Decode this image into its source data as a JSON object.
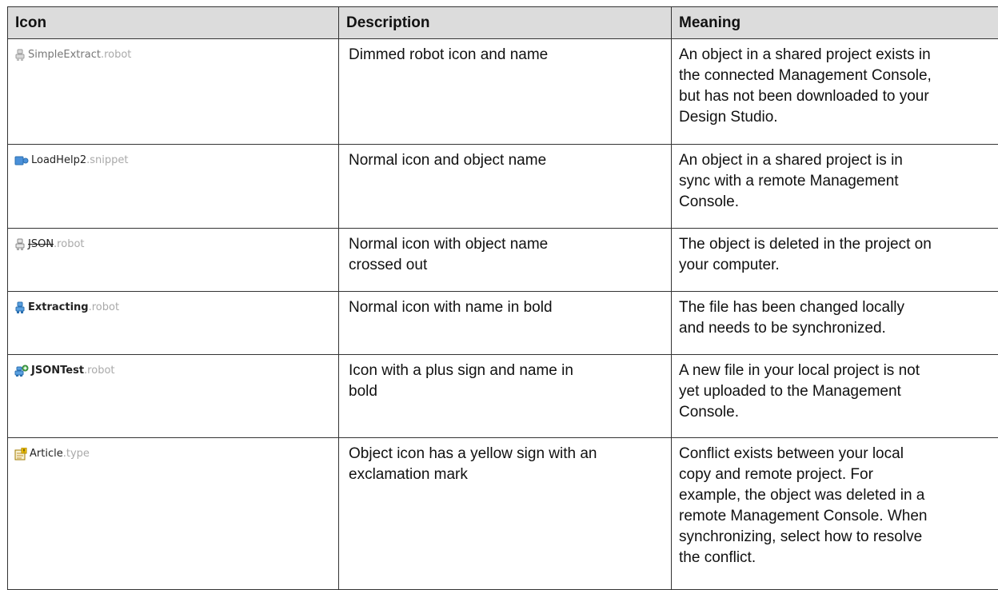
{
  "headers": {
    "icon": "Icon",
    "description": "Description",
    "meaning": "Meaning"
  },
  "rows": [
    {
      "icon_name": "robot-dimmed-icon",
      "name": "SimpleExtract",
      "ext": ".robot",
      "description": [
        "Dimmed robot icon and name"
      ],
      "meaning": [
        "An object in a shared project exists in",
        "the connected Management Console,",
        "but has not been downloaded to your",
        "Design Studio."
      ]
    },
    {
      "icon_name": "snippet-icon",
      "name": "LoadHelp2",
      "ext": ".snippet",
      "description": [
        "Normal icon and object name"
      ],
      "meaning": [
        "An object in a shared project is in",
        "sync with a remote Management",
        "Console."
      ]
    },
    {
      "icon_name": "robot-icon",
      "name": "JSON",
      "ext": ".robot",
      "description": [
        "Normal icon with object name",
        "crossed out"
      ],
      "meaning": [
        "The object is deleted in the project on",
        "your computer."
      ]
    },
    {
      "icon_name": "robot-blue-icon",
      "name": "Extracting",
      "ext": ".robot",
      "description": [
        "Normal icon with name in bold"
      ],
      "meaning": [
        "The file has been changed locally",
        "and needs to be synchronized."
      ]
    },
    {
      "icon_name": "robot-plus-icon",
      "name": "JSONTest",
      "ext": ".robot",
      "description": [
        "Icon with a plus sign and name in",
        "bold"
      ],
      "meaning": [
        "A new file in your local project is not",
        "yet uploaded to the Management",
        "Console."
      ]
    },
    {
      "icon_name": "type-conflict-icon",
      "name": "Article",
      "ext": ".type",
      "description": [
        "Object icon has a yellow sign with an",
        "exclamation mark"
      ],
      "meaning": [
        "Conflict exists between your local",
        "copy and remote project. For",
        "example, the object was deleted in a",
        "remote Management Console. When",
        "synchronizing, select how to resolve",
        "the conflict."
      ]
    }
  ],
  "colors": {
    "header_bg": "#dcdcdc",
    "border": "#333333",
    "robot_blue": "#2a6fb0",
    "robot_grey": "#9a9a9a",
    "plus_green": "#4caf50",
    "warn_yellow": "#f5c400"
  }
}
